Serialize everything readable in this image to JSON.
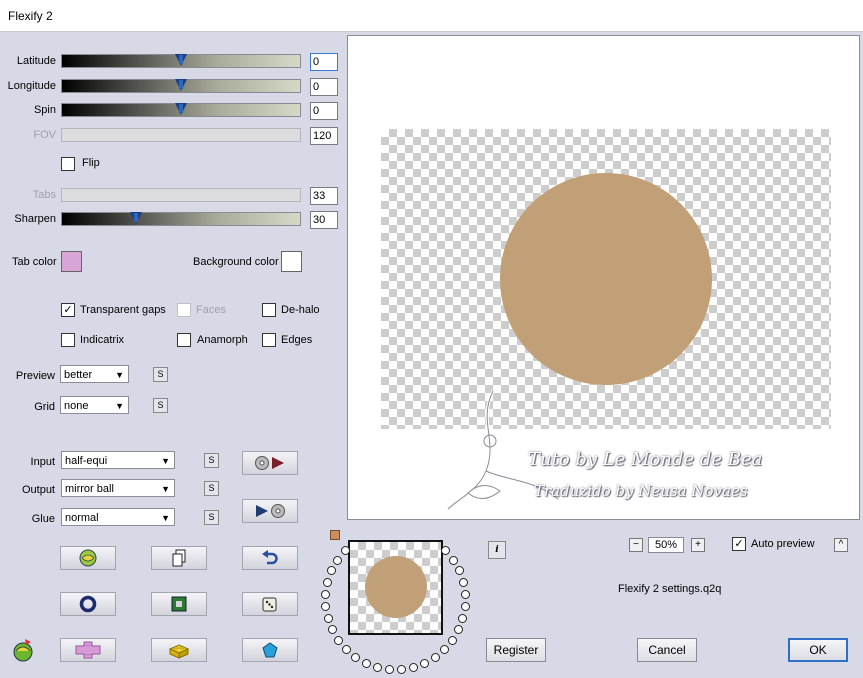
{
  "window": {
    "title": "Flexify 2"
  },
  "sliders": [
    {
      "label": "Latitude",
      "value": "0",
      "level": 0.5,
      "enabled": true
    },
    {
      "label": "Longitude",
      "value": "0",
      "level": 0.5,
      "enabled": true
    },
    {
      "label": "Spin",
      "value": "0",
      "level": 0.5,
      "enabled": true
    },
    {
      "label": "FOV",
      "value": "120",
      "enabled": false
    },
    {
      "label": "Tabs",
      "value": "33",
      "enabled": false
    },
    {
      "label": "Sharpen",
      "value": "30",
      "level": 0.3,
      "enabled": true
    }
  ],
  "flip": {
    "label": "Flip",
    "checked": false
  },
  "colors": {
    "tab_label": "Tab color",
    "tab_color": "#d7a6d7",
    "bg_label": "Background color",
    "bg_color": "#ffffff",
    "circle_color": "#c19f77",
    "accent": "#2f6fc7"
  },
  "options": {
    "transparent_gaps": {
      "label": "Transparent gaps",
      "checked": true
    },
    "faces": {
      "label": "Faces",
      "checked": false
    },
    "dehalo": {
      "label": "De-halo",
      "checked": false
    },
    "indicatrix": {
      "label": "Indicatrix",
      "checked": false
    },
    "anamorph": {
      "label": "Anamorph",
      "checked": false
    },
    "edges": {
      "label": "Edges",
      "checked": false
    }
  },
  "preview_select": {
    "label": "Preview",
    "value": "better"
  },
  "grid_select": {
    "label": "Grid",
    "value": "none"
  },
  "input_select": {
    "label": "Input",
    "value": "half-equi"
  },
  "output_select": {
    "label": "Output",
    "value": "mirror ball"
  },
  "glue_select": {
    "label": "Glue",
    "value": "normal"
  },
  "small_button_label": "S",
  "zoom": {
    "minus": "−",
    "value": "50%",
    "plus": "+"
  },
  "auto_preview": {
    "label": "Auto preview",
    "checked": true,
    "collapse": "^"
  },
  "settings_file": "Flexify 2 settings.q2q",
  "info_label": "i",
  "watermark": {
    "line1": "Tuto by Le Monde de Bea",
    "line2": "Traduzido by Neusa Novaes"
  },
  "buttons": {
    "register": "Register",
    "cancel": "Cancel",
    "ok": "OK"
  },
  "icon_buttons": [
    "randomize-sphere-icon",
    "copy-page-icon",
    "undo-arrow-icon",
    "ring-icon",
    "square-frame-icon",
    "dice-icon",
    "plus-cross-icon",
    "lego-brick-icon",
    "pentagon-gem-icon"
  ]
}
